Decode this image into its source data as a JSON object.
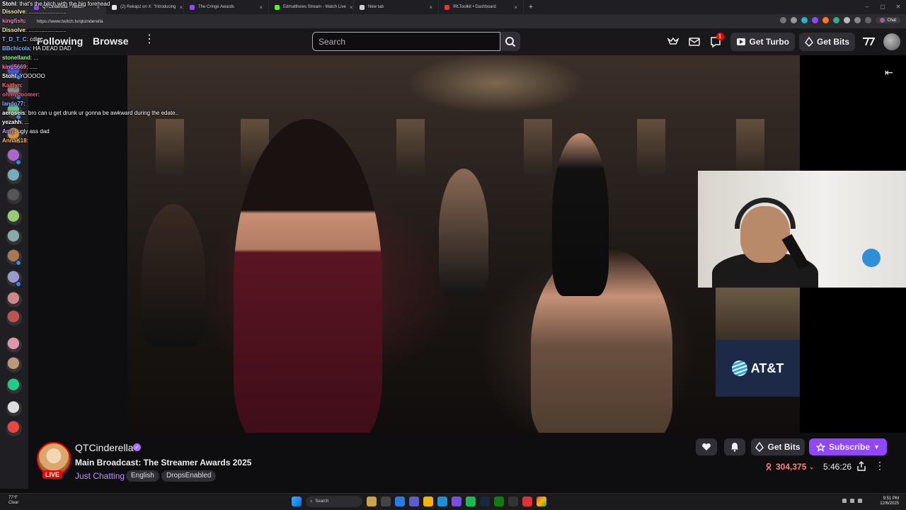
{
  "browser": {
    "tabs": [
      {
        "label": "QTCinderella - Twitch",
        "color": "#9147ff",
        "active": true
      },
      {
        "label": "(2) Rekapz on X: \"Introducing",
        "color": "#e7e7e7"
      },
      {
        "label": "The Cringe Awards",
        "color": "#9147ff"
      },
      {
        "label": "Edmatthews Stream - Watch Live",
        "color": "#53fc18"
      },
      {
        "label": "New tab",
        "color": "#cfcfcf"
      },
      {
        "label": "IRLToolkit • Dashboard",
        "color": "#e33"
      }
    ],
    "new_tab_icon": "+",
    "url": "https://www.twitch.tv/qtcinderella",
    "chat_label": "Chat"
  },
  "nav": {
    "following": "Following",
    "browse": "Browse",
    "search_placeholder": "Search",
    "notification_count": "1",
    "turbo": "Get Turbo",
    "bits": "Get Bits"
  },
  "chat": [
    {
      "user": "Stohl",
      "color": "#ffffff",
      "text": "that's the bitch with the big forehead"
    },
    {
      "user": "Dissolve",
      "color": "#f2f2a6",
      "text": "........................"
    },
    {
      "user": "kingfish",
      "color": "#ff7fbf",
      "text": ""
    },
    {
      "user": "Dissolve",
      "color": "#f2f2a6",
      "text": "........................"
    },
    {
      "user": "T_D_T_C",
      "color": "#7fb2ff",
      "text": "cdinc"
    },
    {
      "user": "BBchicola",
      "color": "#7fb2ff",
      "text": "HA DEAD DAD"
    },
    {
      "user": "stonelland",
      "color": "#8eff8e",
      "text": "..."
    },
    {
      "user": "king5669",
      "color": "#ff7fbf",
      "text": "....."
    },
    {
      "user": "Stohl",
      "color": "#ffffff",
      "text": "YOOOOO"
    },
    {
      "user": "Kaitlyn",
      "color": "#ff6a6a",
      "text": ""
    },
    {
      "user": "ohmydoomer",
      "color": "#ff4f8b",
      "text": ""
    },
    {
      "user": "lando77",
      "color": "#7fb2ff",
      "text": ""
    },
    {
      "user": "aeroseis",
      "color": "#ffffff",
      "text": "bro can u get drunk ur gonna be awkward during the edate.."
    },
    {
      "user": "yezahh",
      "color": "#ffffff",
      "text": "..."
    },
    {
      "user": "Amy",
      "color": "#c69bff",
      "text": "ugly ass dad"
    },
    {
      "user": "AnnaK18",
      "color": "#ffb25a",
      "text": ""
    }
  ],
  "channel": {
    "name": "QTCinderella",
    "live": "LIVE",
    "title": "Main Broadcast: The Streamer Awards 2025",
    "category": "Just Chatting",
    "tags": [
      "English",
      "DropsEnabled"
    ],
    "get_bits": "Get Bits",
    "subscribe": "Subscribe",
    "viewers": "304,375",
    "uptime": "5:46:26"
  },
  "sponsor": "AT&T",
  "taskbar": {
    "temp": "77°F",
    "weather": "Clear",
    "search": "Search",
    "time": "9:51 PM",
    "date": "12/6/2025"
  }
}
